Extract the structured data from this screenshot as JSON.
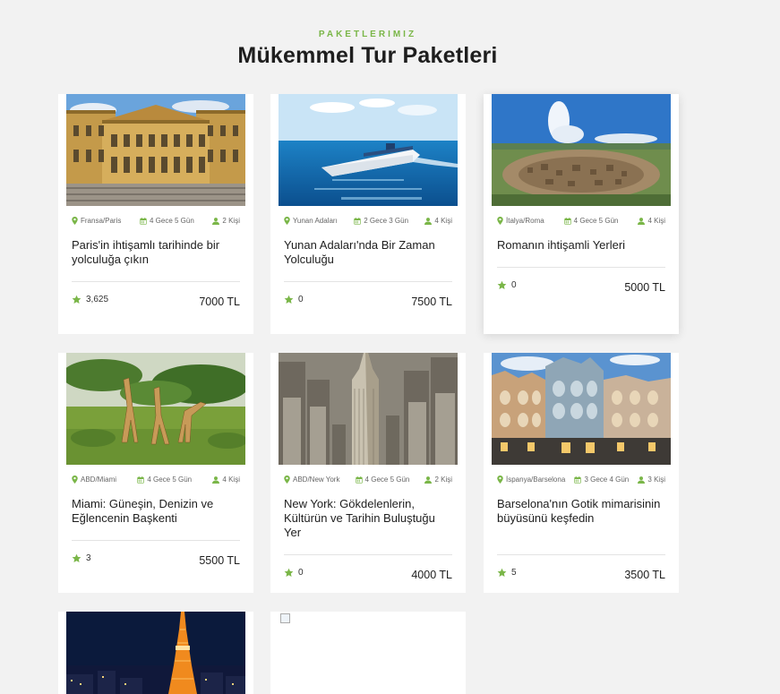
{
  "section": {
    "eyebrow": "PAKETLERIMIZ",
    "title": "Mükemmel Tur Paketleri"
  },
  "colors": {
    "accent": "#7ab648",
    "background": "#f2f2f2"
  },
  "icons": [
    "map-marker-icon",
    "calendar-icon",
    "user-icon",
    "star-icon"
  ],
  "packages": [
    {
      "location": "Fransa/Paris",
      "duration": "4 Gece 5 Gün",
      "people": "2 Kişi",
      "title": "Paris'in ihtişamlı tarihinde bir yolculuğa çıkın",
      "rating": "3,625",
      "price": "7000 TL"
    },
    {
      "location": "Yunan Adaları",
      "duration": "2 Gece 3 Gün",
      "people": "4 Kişi",
      "title": "Yunan Adaları'nda Bir Zaman Yolculuğu",
      "rating": "0",
      "price": "7500 TL"
    },
    {
      "location": "İtalya/Roma",
      "duration": "4 Gece 5 Gün",
      "people": "4 Kişi",
      "title": "Romanın ihtişamli Yerleri",
      "rating": "0",
      "price": "5000 TL"
    },
    {
      "location": "ABD/Miami",
      "duration": "4 Gece 5 Gün",
      "people": "4 Kişi",
      "title": "Miami: Güneşin, Denizin ve Eğlencenin Başkenti",
      "rating": "3",
      "price": "5500 TL"
    },
    {
      "location": "ABD/New York",
      "duration": "4 Gece 5 Gün",
      "people": "2 Kişi",
      "title": "New York: Gökdelenlerin, Kültürün ve Tarihin Buluştuğu Yer",
      "rating": "0",
      "price": "4000 TL"
    },
    {
      "location": "İspanya/Barselona",
      "duration": "3 Gece 4 Gün",
      "people": "3 Kişi",
      "title": "Barselona'nın Gotik mimarisinin büyüsünü keşfedin",
      "rating": "5",
      "price": "3500 TL"
    }
  ]
}
